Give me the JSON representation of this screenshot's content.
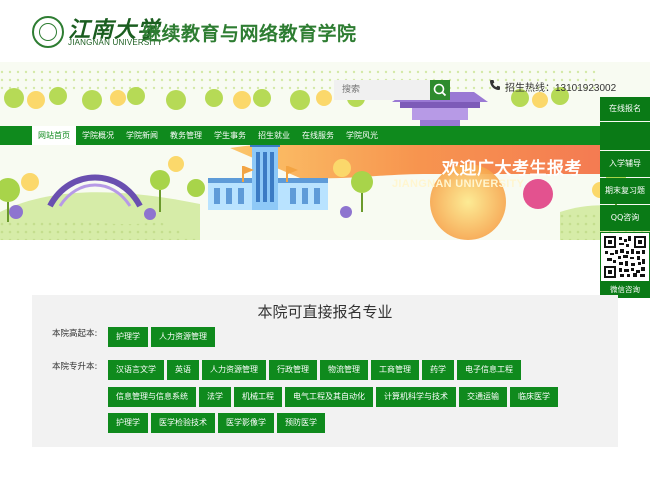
{
  "header": {
    "logo_script": "江南大学",
    "logo_university": "JIANGNAN UNIVERSITY",
    "school_name": "继续教育与网络教育学院"
  },
  "search": {
    "placeholder": "搜索"
  },
  "hotline": {
    "text": "招生热线：13101923002"
  },
  "nav": {
    "items": [
      "网站首页",
      "学院概况",
      "学院新闻",
      "教务管理",
      "学生事务",
      "招生就业",
      "在线服务",
      "学院风光"
    ],
    "active_index": 0
  },
  "sidebar": {
    "items": [
      "在线报名",
      "入学辅导",
      "期末复习题",
      "QQ咨询"
    ],
    "qr_caption": "微信咨询"
  },
  "banner": {
    "headline": "欢迎广大考生报考",
    "subline": "JIANGNAN UNIVERSITY"
  },
  "majors": {
    "title": "本院可直接报名专业",
    "groups": [
      {
        "label": "本院高起本:",
        "rows": [
          [
            "护理学",
            "人力资源管理"
          ]
        ]
      },
      {
        "label": "本院专升本:",
        "rows": [
          [
            "汉语言文学",
            "英语",
            "人力资源管理",
            "行政管理",
            "物流管理",
            "工商管理",
            "药学",
            "电子信息工程"
          ],
          [
            "信息管理与信息系统",
            "法学",
            "机械工程",
            "电气工程及其自动化",
            "计算机科学与技术",
            "交通运输",
            "临床医学"
          ],
          [
            "护理学",
            "医学检验技术",
            "医学影像学",
            "预防医学"
          ]
        ]
      }
    ]
  },
  "colors": {
    "brand_green": "#0f8a1d",
    "dark_green": "#0a7a16",
    "banner_orange": "#f5884a",
    "banner_yellow": "#fbe27c"
  }
}
